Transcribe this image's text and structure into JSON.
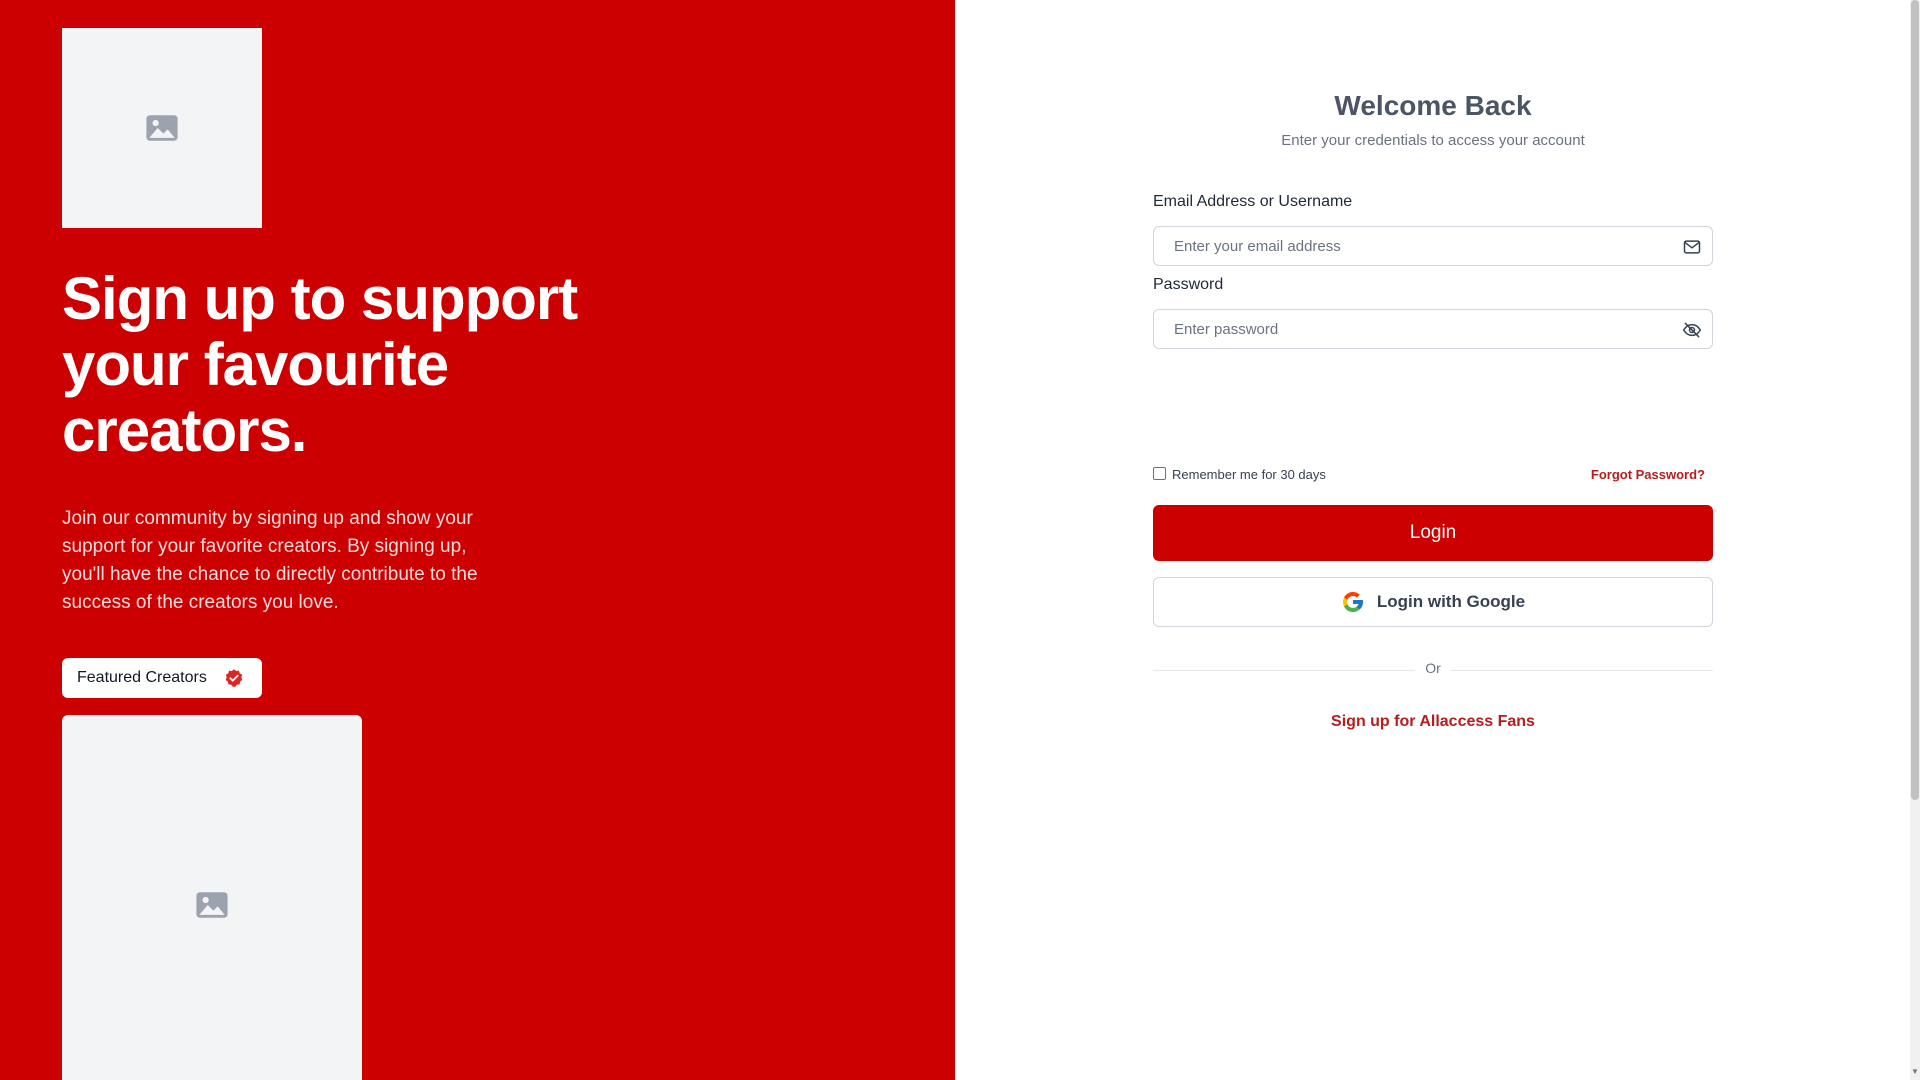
{
  "left": {
    "logo_icon": "image-icon",
    "headline": "Sign up to support your favourite creators.",
    "description": "Join our community by signing up and show your support for your favorite creators. By signing up, you'll have the chance to directly contribute to the success of the creators you love.",
    "featured_label": "Featured Creators",
    "featured_icon": "verified-badge-icon",
    "card_icon": "image-icon"
  },
  "login": {
    "title": "Welcome Back",
    "subtitle": "Enter your credentials to access your account",
    "email_label": "Email Address or Username",
    "email_placeholder": "Enter your email address",
    "email_value": "",
    "email_icon": "mail-icon",
    "password_label": "Password",
    "password_placeholder": "Enter password",
    "password_value": "",
    "password_icon": "eye-off-icon",
    "remember_label": "Remember me for 30 days",
    "remember_checked": false,
    "forgot_label": "Forgot Password?",
    "login_button": "Login",
    "google_button": "Login with Google",
    "google_icon": "google-icon",
    "divider_text": "Or",
    "signup_link": "Sign up for Allaccess Fans"
  },
  "colors": {
    "brand_red": "#cc0000",
    "link_red": "#b91c1c"
  }
}
